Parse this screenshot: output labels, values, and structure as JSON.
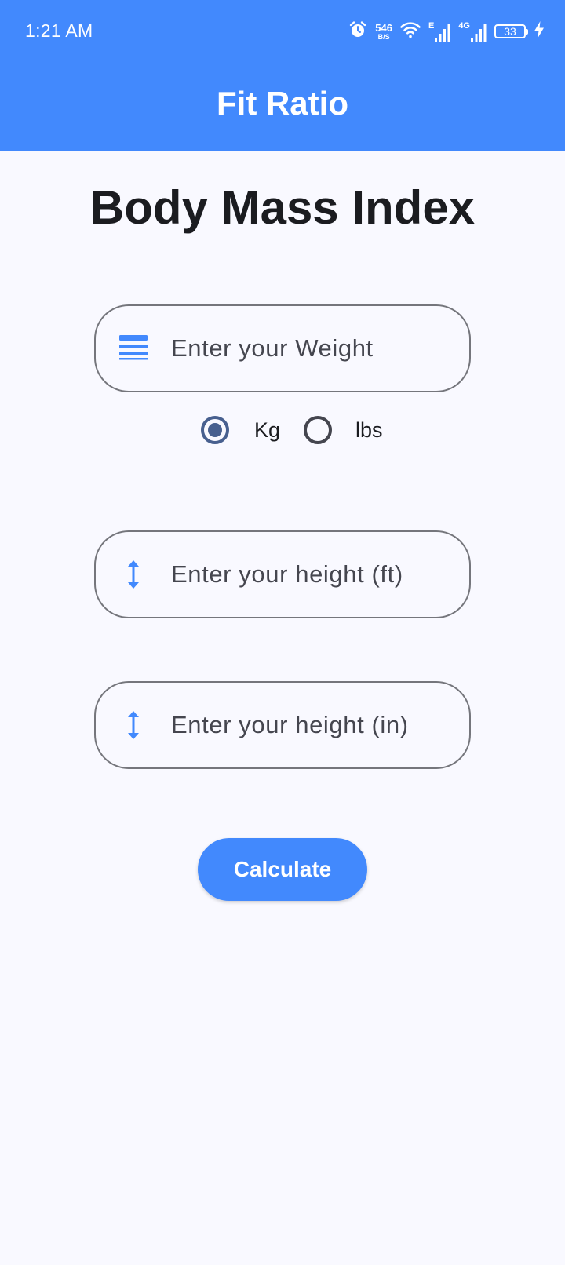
{
  "status_bar": {
    "time": "1:21 AM",
    "net_speed_value": "546",
    "net_speed_unit": "B/S",
    "signal1_label": "E",
    "signal2_label": "4G",
    "battery_level": "33"
  },
  "app_bar": {
    "title": "Fit Ratio",
    "color": "#4289fd"
  },
  "page": {
    "heading": "Body Mass Index"
  },
  "weight_field": {
    "placeholder": "Enter your Weight",
    "icon": "scale-lines-icon"
  },
  "unit_options": {
    "selected": "Kg",
    "options": [
      {
        "label": "Kg",
        "selected": true
      },
      {
        "label": "lbs",
        "selected": false
      }
    ]
  },
  "height_ft_field": {
    "placeholder": "Enter your height (ft)",
    "icon": "vertical-resize-icon"
  },
  "height_in_field": {
    "placeholder": "Enter your height (in)",
    "icon": "vertical-resize-icon"
  },
  "calculate_button": {
    "label": "Calculate"
  }
}
